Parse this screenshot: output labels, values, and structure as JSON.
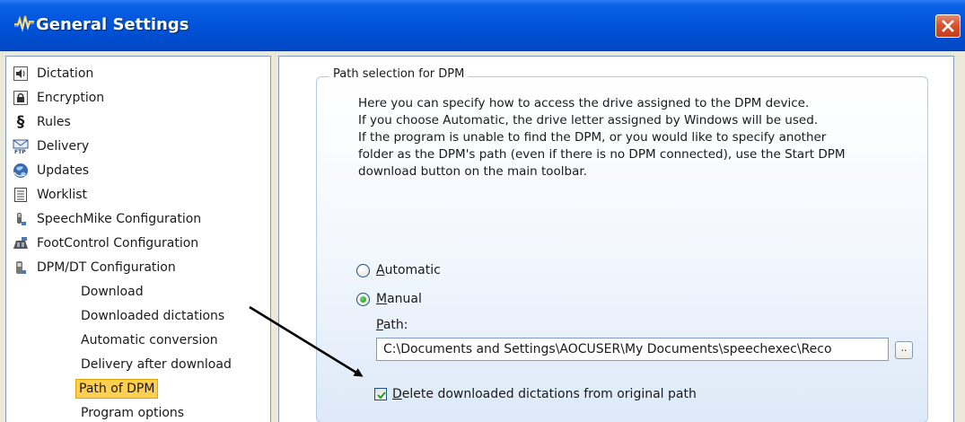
{
  "window": {
    "title": "General Settings",
    "title_icon": "speech-waveform-icon",
    "close_icon": "close-icon"
  },
  "tree": {
    "items": [
      {
        "label": "Dictation",
        "icon": "speaker-icon"
      },
      {
        "label": "Encryption",
        "icon": "lock-icon"
      },
      {
        "label": "Rules",
        "icon": "section-icon"
      },
      {
        "label": "Delivery",
        "icon": "ftp-mail-icon"
      },
      {
        "label": "Updates",
        "icon": "globe-icon"
      },
      {
        "label": "Worklist",
        "icon": "list-icon"
      },
      {
        "label": "SpeechMike Configuration",
        "icon": "microphone-icon"
      },
      {
        "label": "FootControl Configuration",
        "icon": "footcontrol-icon"
      },
      {
        "label": "DPM/DT Configuration",
        "icon": "recorder-icon"
      }
    ],
    "subitems": [
      {
        "label": "Download"
      },
      {
        "label": "Downloaded dictations"
      },
      {
        "label": "Automatic conversion"
      },
      {
        "label": "Delivery after download"
      },
      {
        "label": "Path of DPM",
        "selected": true
      },
      {
        "label": "Program options"
      }
    ]
  },
  "panel": {
    "group_title": "Path selection for DPM",
    "description": [
      "Here you can specify how to access the drive assigned to the DPM device.",
      "If you choose Automatic, the drive letter assigned by Windows will be used.",
      "If the program is unable to find the DPM, or you would like to specify another",
      "folder as the DPM's path (even if there is no DPM connected), use the Start DPM",
      "download button on the main toolbar."
    ],
    "radio_automatic": {
      "first": "A",
      "rest": "utomatic",
      "selected": false
    },
    "radio_manual": {
      "first": "M",
      "rest": "anual",
      "selected": true
    },
    "path_label": {
      "first": "P",
      "rest": "ath:"
    },
    "path_value": "C:\\Documents and Settings\\AOCUSER\\My Documents\\speechexec\\Reco",
    "browse_label": "..",
    "delete_checkbox": {
      "first": "D",
      "rest": "elete downloaded dictations from original path",
      "checked": true
    }
  },
  "colors": {
    "titlebar": "#0052d8",
    "selection": "#ffcf51",
    "radio_dot": "#21a121"
  }
}
